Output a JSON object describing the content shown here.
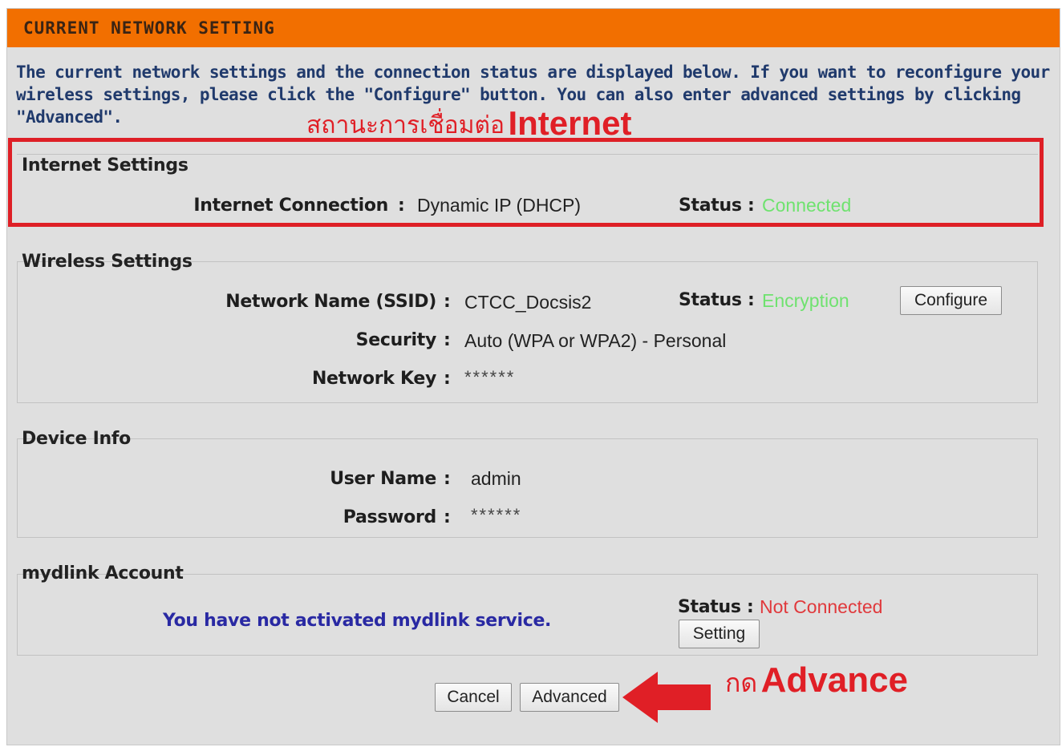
{
  "header": {
    "title": "CURRENT NETWORK SETTING"
  },
  "intro": "The current network settings and the connection status are displayed below. If you want to reconfigure your wireless settings, please click the \"Configure\" button. You can also enter advanced settings by clicking \"Advanced\".",
  "annotations": {
    "internet_thai": "สถานะการเชื่อมต่อ",
    "internet_eng": "Internet",
    "advance_thai": "กด",
    "advance_eng": "Advance",
    "color": "#e01f26"
  },
  "internet": {
    "title": "Internet Settings",
    "connection_label": "Internet Connection",
    "connection_value": "Dynamic IP (DHCP)",
    "status_label": "Status :",
    "status_value": "Connected"
  },
  "wireless": {
    "title": "Wireless Settings",
    "ssid_label": "Network Name (SSID)",
    "ssid_value": "CTCC_Docsis2",
    "status_label": "Status :",
    "status_value": "Encryption",
    "configure_button": "Configure",
    "security_label": "Security",
    "security_value": "Auto (WPA or WPA2) - Personal",
    "key_label": "Network Key",
    "key_value": "******"
  },
  "device": {
    "title": "Device Info",
    "username_label": "User Name",
    "username_value": "admin",
    "password_label": "Password",
    "password_value": "******"
  },
  "mydlink": {
    "title": "mydlink Account",
    "message": "You have not activated mydlink service.",
    "status_label": "Status :",
    "status_value": "Not Connected",
    "setting_button": "Setting"
  },
  "footer": {
    "cancel_button": "Cancel",
    "advanced_button": "Advanced"
  },
  "colors": {
    "header": "#f26f00",
    "status_ok": "#6fe26f",
    "status_bad": "#e0393c",
    "mydlink_message": "#2929a3"
  }
}
